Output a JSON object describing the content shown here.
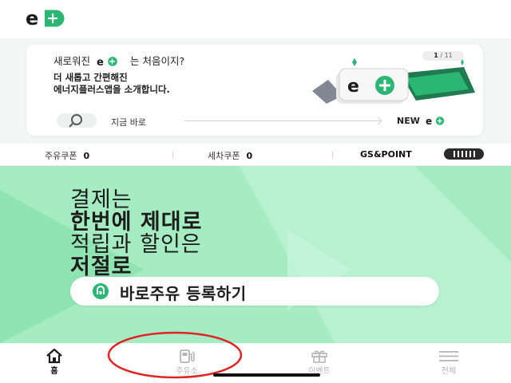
{
  "colors": {
    "brand_green": "#2bb673",
    "banner_bg": "#a5ecc2",
    "annotation_red": "#e02424"
  },
  "header": {
    "logo_icon": "ep-logo-icon"
  },
  "promo": {
    "question_prefix": "새로워진",
    "question_suffix": "는 처음이지?",
    "line1": "더 새롭고 간편해진",
    "line2": "에너지플러스앱을 소개합니다.",
    "pager_current": "1",
    "pager_total": "/ 11",
    "foot_text": "지금 바로",
    "foot_new": "NEW"
  },
  "coupons": {
    "fuel_label": "주유쿠폰",
    "fuel_count": "0",
    "wash_label": "세차쿠폰",
    "wash_count": "0",
    "gs_point_label": "GS&POINT"
  },
  "banner": {
    "line1": "결제는",
    "line2": "한번에 제대로",
    "line3": "적립과 할인은",
    "line4": "저절로",
    "cta_label": "바로주유 등록하기"
  },
  "nav": {
    "items": [
      {
        "label": "홈",
        "icon": "home-icon",
        "active": true
      },
      {
        "label": "주유소",
        "icon": "gas-station-icon",
        "active": false
      },
      {
        "label": "이벤트",
        "icon": "gift-icon",
        "active": false
      },
      {
        "label": "전체",
        "icon": "menu-icon",
        "active": false
      }
    ]
  }
}
